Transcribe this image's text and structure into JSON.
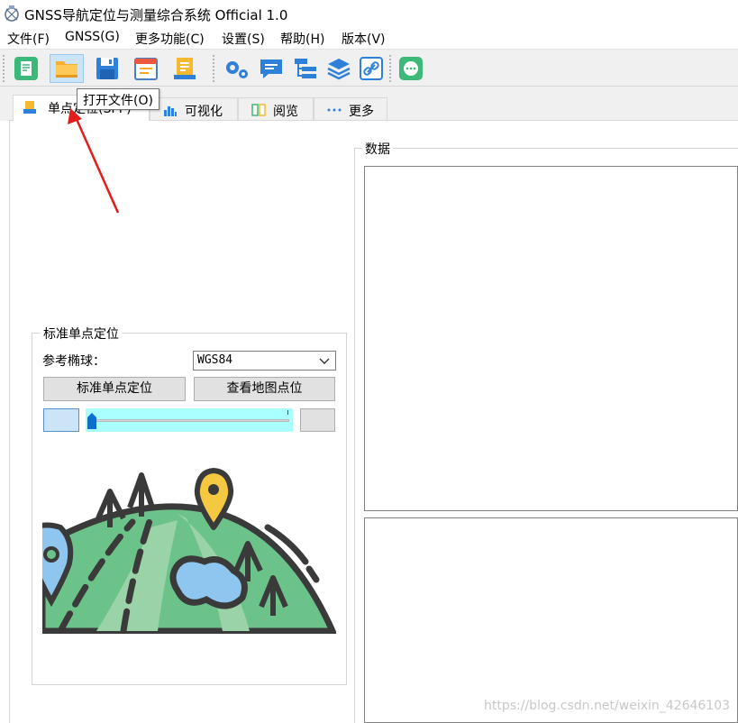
{
  "window": {
    "title": "GNSS导航定位与测量综合系统 Official 1.0",
    "icon": "satellite-app-icon"
  },
  "menu": [
    {
      "label": "文件(F)"
    },
    {
      "label": "GNSS(G)"
    },
    {
      "label": "更多功能(C)"
    },
    {
      "label": "设置(S)"
    },
    {
      "label": "帮助(H)"
    },
    {
      "label": "版本(V)"
    }
  ],
  "toolbar": {
    "buttons": [
      "new-file-icon",
      "open-folder-icon",
      "save-icon",
      "calendar-form-icon",
      "notepad-icon",
      "gears-icon",
      "chat-icon",
      "tree-list-icon",
      "layers-icon",
      "link-icon",
      "message-icon"
    ],
    "tooltip": "打开文件(O)"
  },
  "tabs": [
    {
      "label": "单点定位(SPP)",
      "icon": "inbox-icon",
      "selected": true
    },
    {
      "label": "可视化",
      "icon": "bar-chart-icon"
    },
    {
      "label": "阅览",
      "icon": "book-icon"
    },
    {
      "label": "更多",
      "icon": "more-dots-icon"
    }
  ],
  "spp_group": {
    "title": "标准单点定位",
    "ellipsoid_label": "参考椭球：",
    "ellipsoid_value": "WGS84",
    "btn_spp": "标准单点定位",
    "btn_map": "查看地图点位"
  },
  "data_group": {
    "title": "数据"
  },
  "watermark": "https://blog.csdn.net/weixin_42646103",
  "colors": {
    "toolbar_bg": "#f0f0f0",
    "slider_bg": "#aaffff",
    "hill_green": "#6cc38a",
    "pin_yellow": "#f5c842",
    "lake_blue": "#8ec6f0",
    "arrow_red": "#e31c1c"
  }
}
